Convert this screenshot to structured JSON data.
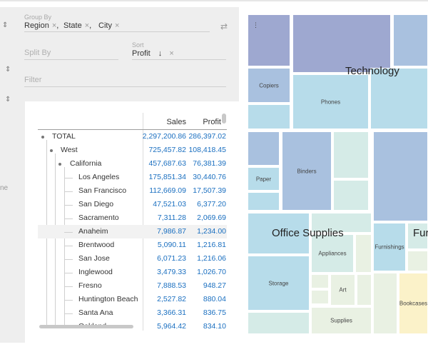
{
  "left_strip": {
    "chevrons": [
      "⇕",
      "⇕",
      "⇕"
    ],
    "partial_text": "ne"
  },
  "group_by": {
    "label": "Group By",
    "pills": [
      {
        "text": "Region",
        "remove": "×",
        "sep": ","
      },
      {
        "text": "State",
        "remove": "×",
        "sep": ","
      },
      {
        "text": "City",
        "remove": "×",
        "sep": ""
      }
    ],
    "swap_icon": "⇄"
  },
  "split_by": {
    "placeholder": "Split By"
  },
  "sort": {
    "label": "Sort",
    "value": "Profit",
    "direction": "↓",
    "remove": "×"
  },
  "filter": {
    "placeholder": "Filter"
  },
  "table": {
    "columns": {
      "sales": "Sales",
      "profit": "Profit"
    },
    "rows": [
      {
        "label": "TOTAL",
        "sales": "2,297,200.86",
        "profit": "286,397.02"
      },
      {
        "label": "West",
        "sales": "725,457.82",
        "profit": "108,418.45"
      },
      {
        "label": "California",
        "sales": "457,687.63",
        "profit": "76,381.39"
      },
      {
        "label": "Los Angeles",
        "sales": "175,851.34",
        "profit": "30,440.76"
      },
      {
        "label": "San Francisco",
        "sales": "112,669.09",
        "profit": "17,507.39"
      },
      {
        "label": "San Diego",
        "sales": "47,521.03",
        "profit": "6,377.20"
      },
      {
        "label": "Sacramento",
        "sales": "7,311.28",
        "profit": "2,069.69"
      },
      {
        "label": "Anaheim",
        "sales": "7,986.87",
        "profit": "1,234.00"
      },
      {
        "label": "Brentwood",
        "sales": "5,090.11",
        "profit": "1,216.81"
      },
      {
        "label": "San Jose",
        "sales": "6,071.23",
        "profit": "1,216.06"
      },
      {
        "label": "Inglewood",
        "sales": "3,479.33",
        "profit": "1,026.70"
      },
      {
        "label": "Fresno",
        "sales": "7,888.53",
        "profit": "948.27"
      },
      {
        "label": "Huntington Beach",
        "sales": "2,527.82",
        "profit": "880.04"
      },
      {
        "label": "Santa Ana",
        "sales": "3,366.31",
        "profit": "836.75"
      },
      {
        "label": "Oakland",
        "sales": "5,964.42",
        "profit": "834.10"
      }
    ]
  },
  "treemap": {
    "groups": [
      "Technology",
      "Office Supplies",
      "Fur"
    ],
    "tiles": [
      "Copiers",
      "Phones",
      "Paper",
      "Binders",
      "Appliances",
      "Storage",
      "Art",
      "Supplies",
      "Furnishings",
      "Bookcases"
    ],
    "colors": {
      "dark": "#9ea8d0",
      "mid": "#a9c1df",
      "light": "#b7dcea",
      "pale": "#d5ebe7",
      "paler": "#e9f1e3",
      "yellow": "#fbf2c9"
    }
  }
}
